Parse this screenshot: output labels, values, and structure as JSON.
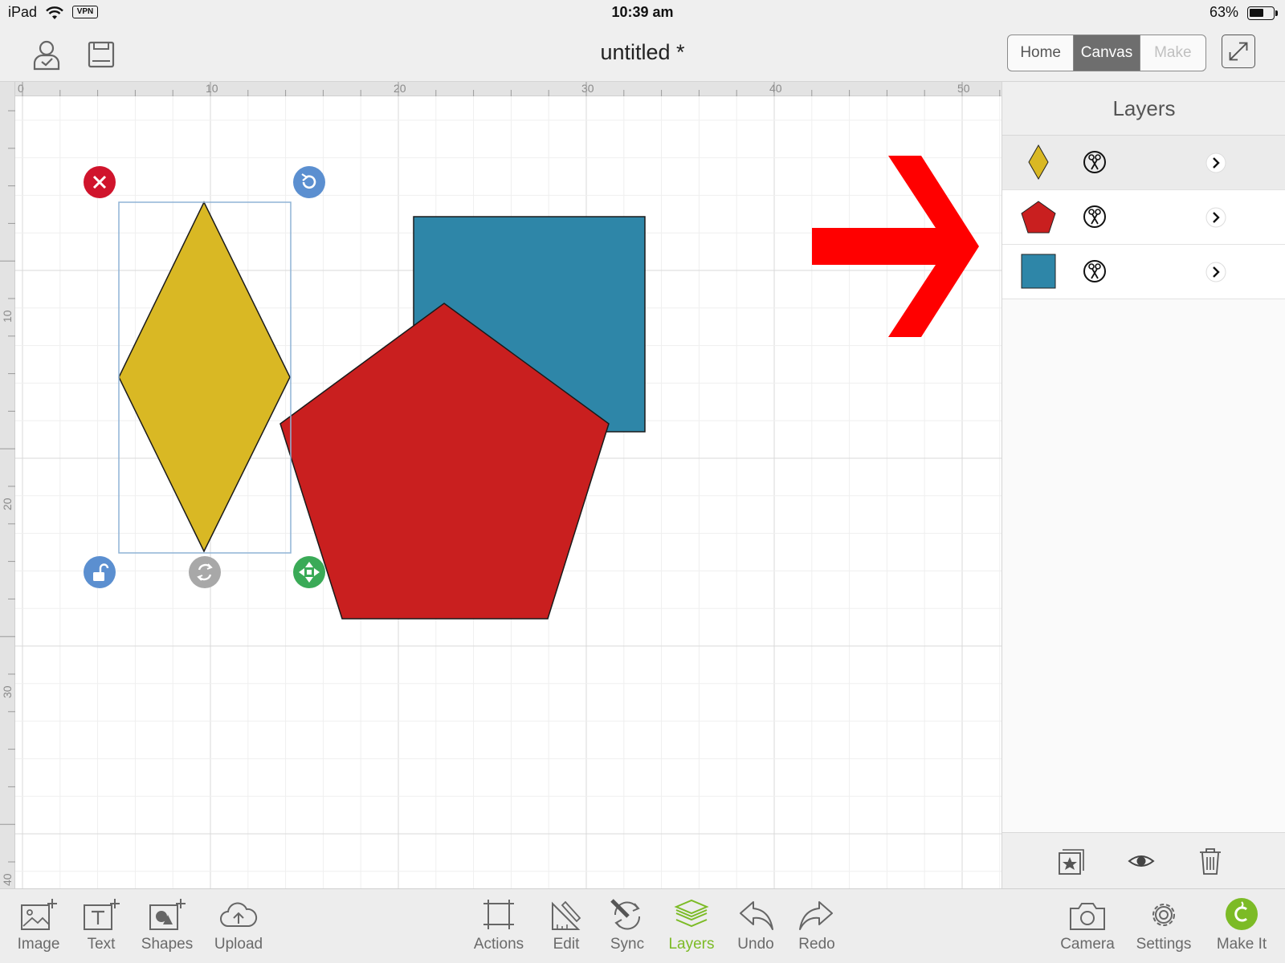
{
  "status_bar": {
    "device": "iPad",
    "vpn": "VPN",
    "time": "10:39 am",
    "battery_text": "63%",
    "battery_level": 0.63
  },
  "header": {
    "title": "untitled *",
    "user_icon": "user-check-icon",
    "save_icon": "save-icon",
    "segments": [
      {
        "label": "Home",
        "state": "normal"
      },
      {
        "label": "Canvas",
        "state": "active"
      },
      {
        "label": "Make",
        "state": "disabled"
      }
    ],
    "expand_icon": "expand-arrows-icon"
  },
  "rulers": {
    "top_labels": [
      "0",
      "10",
      "20",
      "30",
      "40",
      "50"
    ],
    "left_labels": [
      "10",
      "20",
      "30",
      "40"
    ]
  },
  "canvas": {
    "shapes": [
      {
        "type": "diamond",
        "color": "#d9b824",
        "selected": true
      },
      {
        "type": "square",
        "color": "#2e86a8"
      },
      {
        "type": "pentagon",
        "color": "#c91f1f"
      }
    ],
    "annotation_arrow_color": "#ff0000",
    "selection_handles": [
      {
        "name": "delete-handle",
        "icon": "close-icon",
        "color": "#d0142c"
      },
      {
        "name": "rotate-handle",
        "icon": "rotate-icon",
        "color": "#5b8fd0"
      },
      {
        "name": "lock-handle",
        "icon": "unlock-icon",
        "color": "#5b8fd0"
      },
      {
        "name": "flip-handle",
        "icon": "flip-icon",
        "color": "#a8a8a8"
      },
      {
        "name": "resize-handle",
        "icon": "move-arrows-icon",
        "color": "#3aaa57"
      }
    ]
  },
  "layers_panel": {
    "title": "Layers",
    "items": [
      {
        "shape": "diamond",
        "color": "#d9b824",
        "operation_icon": "scissors-cut-icon",
        "selected": true
      },
      {
        "shape": "pentagon",
        "color": "#c91f1f",
        "operation_icon": "scissors-cut-icon",
        "selected": false
      },
      {
        "shape": "square",
        "color": "#2e86a8",
        "operation_icon": "scissors-cut-icon",
        "selected": false
      }
    ],
    "footer_icons": [
      "image-star-icon",
      "eye-icon",
      "trash-icon"
    ]
  },
  "bottom_toolbar": {
    "left": [
      {
        "label": "Image",
        "icon": "image-add-icon"
      },
      {
        "label": "Text",
        "icon": "text-add-icon"
      },
      {
        "label": "Shapes",
        "icon": "shapes-add-icon"
      },
      {
        "label": "Upload",
        "icon": "cloud-upload-icon"
      }
    ],
    "center": [
      {
        "label": "Actions",
        "icon": "actions-icon"
      },
      {
        "label": "Edit",
        "icon": "edit-icon"
      },
      {
        "label": "Sync",
        "icon": "sync-icon"
      },
      {
        "label": "Layers",
        "icon": "layers-icon",
        "active": true
      },
      {
        "label": "Undo",
        "icon": "undo-icon"
      },
      {
        "label": "Redo",
        "icon": "redo-icon"
      }
    ],
    "right": [
      {
        "label": "Camera",
        "icon": "camera-icon"
      },
      {
        "label": "Settings",
        "icon": "gear-icon"
      },
      {
        "label": "Make It",
        "icon": "make-it-icon"
      }
    ],
    "active_color": "#7cbb26"
  }
}
